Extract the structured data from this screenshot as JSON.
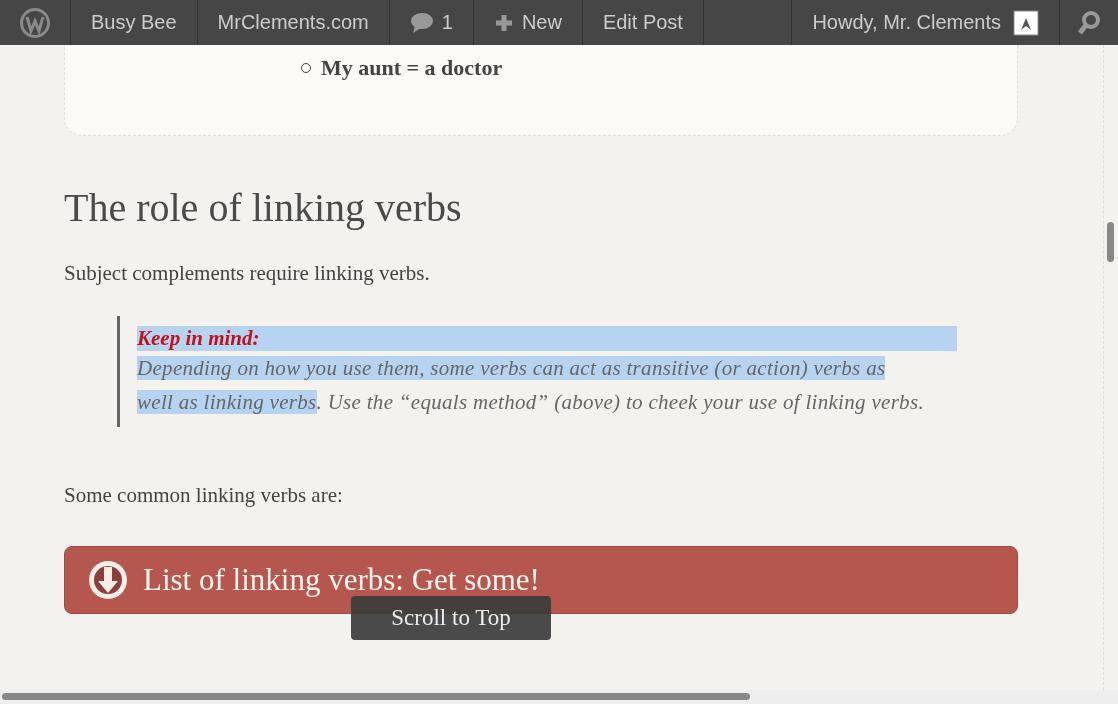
{
  "admin_bar": {
    "items": [
      {
        "kind": "logo"
      },
      {
        "kind": "link",
        "label": "Busy Bee"
      },
      {
        "kind": "link",
        "label": "MrClements.com"
      },
      {
        "kind": "comments",
        "label": "1"
      },
      {
        "kind": "new",
        "label": "New"
      },
      {
        "kind": "link",
        "label": "Edit Post"
      }
    ],
    "account": {
      "label": "Howdy, Mr. Clements"
    },
    "search": {
      "kind": "search"
    }
  },
  "card": {
    "list": [
      "My aunt = a doctor"
    ]
  },
  "heading": "The role of linking verbs",
  "intro": "Subject complements require linking verbs.",
  "callout": {
    "title": "Keep in mind:",
    "title_selected": true,
    "segments": [
      {
        "text": "Depending on how you use them, some verbs can act as transitive (or action) verbs as well as linking verbs",
        "selected": true
      },
      {
        "text": ". Use the “equals method” (above) to cheek your use of linking verbs.",
        "selected": false
      }
    ]
  },
  "lead": "Some common linking verbs are:",
  "download_button": {
    "label": "List of linking verbs: Get some!"
  },
  "scroll_top": {
    "label": "Scroll to Top"
  }
}
